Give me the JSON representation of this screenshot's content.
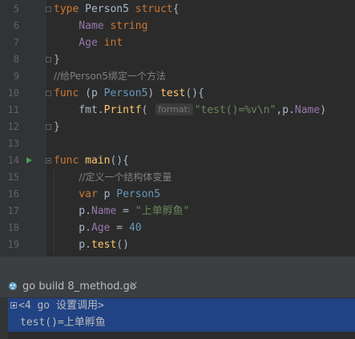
{
  "editor": {
    "lines": [
      {
        "num": "5",
        "fold": true,
        "tokens": [
          {
            "t": "type ",
            "c": "kw"
          },
          {
            "t": "Person5 ",
            "c": "pl"
          },
          {
            "t": "struct",
            "c": "kw"
          },
          {
            "t": "{",
            "c": "pl"
          }
        ]
      },
      {
        "num": "6",
        "tokens": [
          {
            "t": "    Name ",
            "c": "fi"
          },
          {
            "t": "string",
            "c": "kw"
          }
        ]
      },
      {
        "num": "7",
        "tokens": [
          {
            "t": "    Age ",
            "c": "fi"
          },
          {
            "t": "int",
            "c": "kw"
          }
        ]
      },
      {
        "num": "8",
        "fold": true,
        "tokens": [
          {
            "t": "}",
            "c": "pl"
          }
        ]
      },
      {
        "num": "9",
        "tokens": [
          {
            "t": "//给Person5绑定一个方法",
            "c": "cmt"
          }
        ]
      },
      {
        "num": "10",
        "fold": true,
        "tokens": [
          {
            "t": "func ",
            "c": "kw"
          },
          {
            "t": "(p ",
            "c": "pl"
          },
          {
            "t": "Person5",
            "c": "ty"
          },
          {
            "t": ") ",
            "c": "pl"
          },
          {
            "t": "test",
            "c": "fn"
          },
          {
            "t": "(){",
            "c": "pl"
          }
        ]
      },
      {
        "num": "11",
        "tokens": [
          {
            "t": "    fmt.",
            "c": "pl"
          },
          {
            "t": "Printf",
            "c": "fn"
          },
          {
            "t": "( ",
            "c": "pl"
          },
          {
            "t": "format:",
            "c": "hint"
          },
          {
            "t": "\"test()=%v\\n\"",
            "c": "str"
          },
          {
            "t": ",p.",
            "c": "pl"
          },
          {
            "t": "Name",
            "c": "fi"
          },
          {
            "t": ")",
            "c": "pl"
          }
        ]
      },
      {
        "num": "12",
        "fold": true,
        "tokens": [
          {
            "t": "}",
            "c": "pl"
          }
        ]
      },
      {
        "num": "13",
        "tokens": []
      },
      {
        "num": "14",
        "run": true,
        "fold": true,
        "open": true,
        "tokens": [
          {
            "t": "func ",
            "c": "kw"
          },
          {
            "t": "main",
            "c": "fn"
          },
          {
            "t": "(){",
            "c": "pl"
          }
        ]
      },
      {
        "num": "15",
        "tokens": [
          {
            "t": "    ",
            "c": "pl"
          },
          {
            "t": "//定义一个结构体变量",
            "c": "cmt"
          }
        ]
      },
      {
        "num": "16",
        "tokens": [
          {
            "t": "    var ",
            "c": "kw"
          },
          {
            "t": "p ",
            "c": "pl"
          },
          {
            "t": "Person5",
            "c": "ty"
          }
        ]
      },
      {
        "num": "17",
        "tokens": [
          {
            "t": "    p.",
            "c": "pl"
          },
          {
            "t": "Name",
            "c": "fi"
          },
          {
            "t": " = ",
            "c": "pl"
          },
          {
            "t": "\"上单孵鱼\"",
            "c": "str"
          }
        ]
      },
      {
        "num": "18",
        "tokens": [
          {
            "t": "    p.",
            "c": "pl"
          },
          {
            "t": "Age",
            "c": "fi"
          },
          {
            "t": " = ",
            "c": "pl"
          },
          {
            "t": "40",
            "c": "num"
          }
        ]
      },
      {
        "num": "19",
        "tokens": [
          {
            "t": "    p.",
            "c": "pl"
          },
          {
            "t": "test",
            "c": "fn"
          },
          {
            "t": "()",
            "c": "pl"
          }
        ]
      }
    ]
  },
  "run_panel": {
    "tab_label": "go build 8_method.go",
    "close_glyph": "×"
  },
  "console": {
    "line1": "<4 go 设置调用>",
    "line2": "test()=上单孵鱼"
  }
}
